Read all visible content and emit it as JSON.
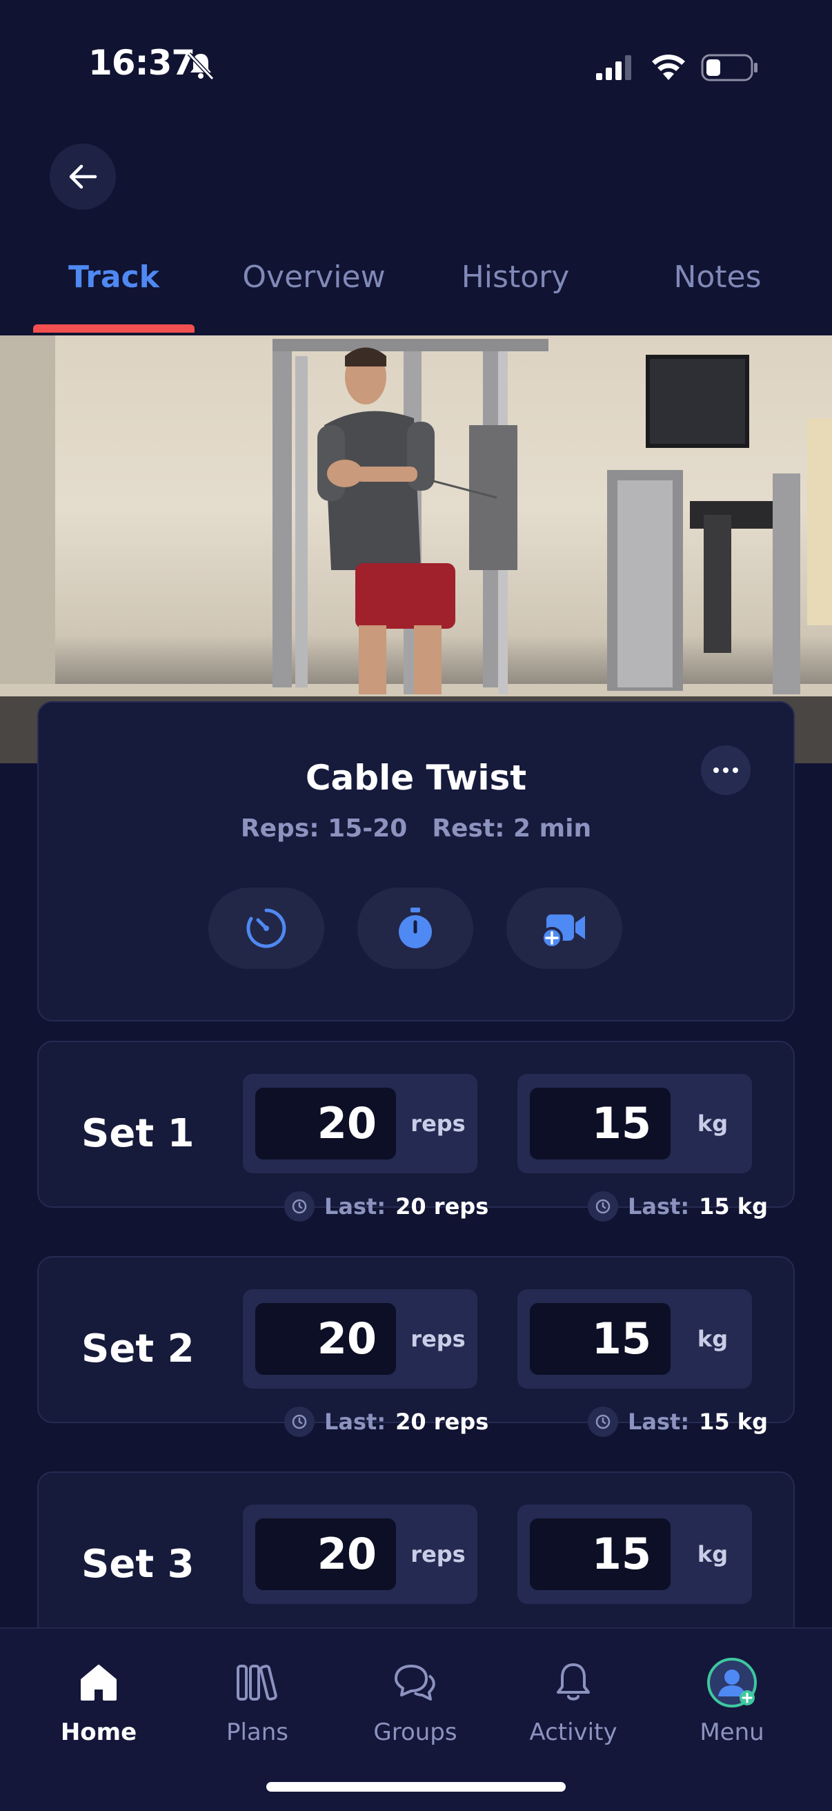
{
  "status_bar": {
    "time": "16:37"
  },
  "tabs": [
    {
      "label": "Track",
      "active": true
    },
    {
      "label": "Overview",
      "active": false
    },
    {
      "label": "History",
      "active": false
    },
    {
      "label": "Notes",
      "active": false
    }
  ],
  "exercise": {
    "title": "Cable Twist",
    "reps": "Reps: 15-20",
    "rest": "Rest: 2 min"
  },
  "sets": [
    {
      "label": "Set 1",
      "reps": "20",
      "reps_unit": "reps",
      "weight": "15",
      "weight_unit": "kg",
      "last_label": "Last:",
      "last_reps": "20 reps",
      "last_weight": "15 kg"
    },
    {
      "label": "Set 2",
      "reps": "20",
      "reps_unit": "reps",
      "weight": "15",
      "weight_unit": "kg",
      "last_label": "Last:",
      "last_reps": "20 reps",
      "last_weight": "15 kg"
    },
    {
      "label": "Set 3",
      "reps": "20",
      "reps_unit": "reps",
      "weight": "15",
      "weight_unit": "kg"
    }
  ],
  "bottom_nav": [
    {
      "label": "Home",
      "icon": "home-icon",
      "active": true
    },
    {
      "label": "Plans",
      "icon": "plans-icon",
      "active": false
    },
    {
      "label": "Groups",
      "icon": "groups-icon",
      "active": false
    },
    {
      "label": "Activity",
      "icon": "bell-icon",
      "active": false
    },
    {
      "label": "Menu",
      "icon": "avatar-icon",
      "active": false
    }
  ],
  "colors": {
    "background": "#101331",
    "accent": "#4f89f3",
    "tab_indicator": "#f25050",
    "card": "#161a3b"
  }
}
